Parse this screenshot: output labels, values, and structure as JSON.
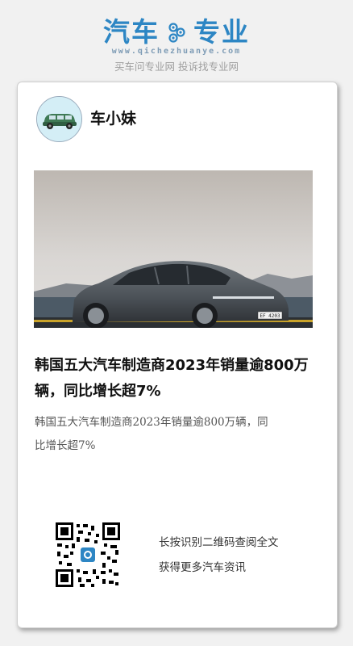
{
  "header": {
    "logo_left": "汽车",
    "logo_right": "专业",
    "url": "www.qichezhuanye.com",
    "slogan": "买车问专业网 投诉找专业网"
  },
  "card": {
    "author": "车小妹",
    "title": "韩国五大汽车制造商2023年销量逾800万辆，同比增长超7%",
    "summary": "韩国五大汽车制造商2023年销量逾800万辆，同比增长超7%",
    "plate": "EF 4203",
    "qr_line1": "长按识别二维码查阅全文",
    "qr_line2": "获得更多汽车资讯"
  },
  "colors": {
    "brand": "#2d86c4",
    "background": "#f1f1f1"
  }
}
